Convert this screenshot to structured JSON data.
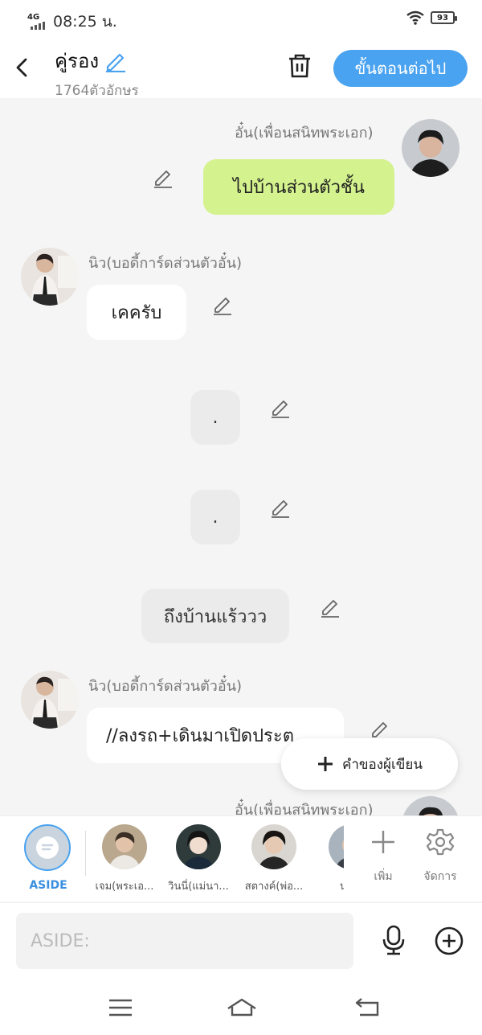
{
  "status": {
    "network": "4G",
    "time": "08:25 น.",
    "battery": "93"
  },
  "header": {
    "title": "คู่รอง",
    "char_count": "1764ตัวอักษร",
    "next_label": "ขั้นตอนต่อไป"
  },
  "messages": [
    {
      "speaker": "อั๋น(เพื่อนสนิทพระเอก)",
      "text": "ไปบ้านส่วนตัวชั้น"
    },
    {
      "speaker": "นิว(บอดี้การ์ดส่วนตัวอั๋น)",
      "text": "เคครับ"
    },
    {
      "text": "."
    },
    {
      "text": "."
    },
    {
      "text": "ถึงบ้านแร้ววว"
    },
    {
      "speaker": "นิว(บอดี้การ์ดส่วนตัวอั๋น)",
      "text": "//ลงรถ+เดินมาเปิดประต"
    },
    {
      "speaker": "อั๋น(เพื่อนสนิทพระเอก)"
    }
  ],
  "float_button": {
    "label": "คำของผู้เขียน"
  },
  "characters": {
    "aside_label": "ASIDE",
    "list": [
      {
        "name": "เจม(พระเอ..."
      },
      {
        "name": "วินนี่(แม่นา..."
      },
      {
        "name": "สตางค์(พ่อ..."
      },
      {
        "name": "นายเ"
      }
    ],
    "add_label": "เพิ่ม",
    "manage_label": "จัดการ"
  },
  "input": {
    "placeholder": "ASIDE:"
  },
  "colors": {
    "accent": "#4aa3f0",
    "green_bubble": "#d4f28e"
  }
}
